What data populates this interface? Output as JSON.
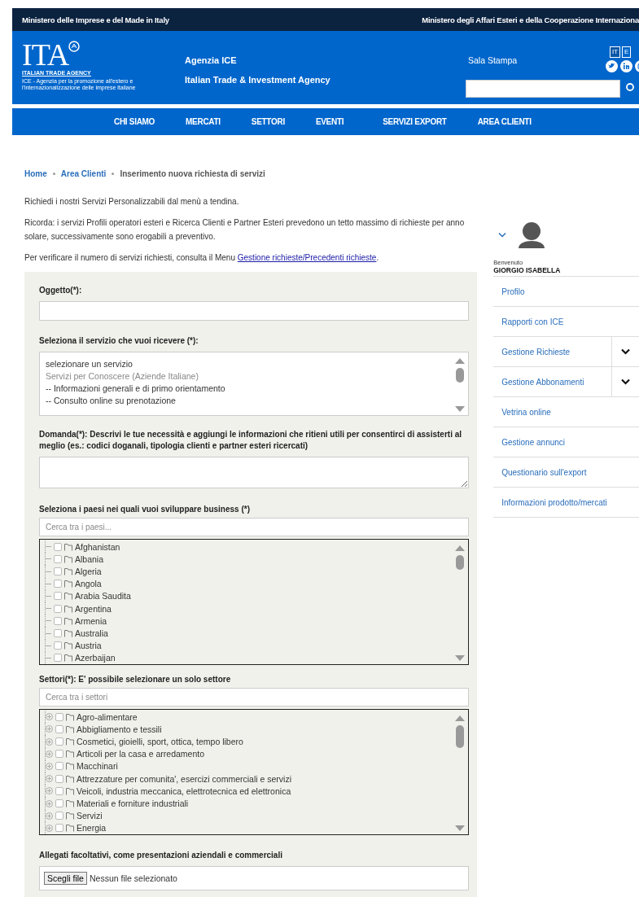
{
  "top_bar": {
    "left": "Ministero delle Imprese e del Made in Italy",
    "right": "Ministero degli Affari Esteri e della Cooperazione Internaziona"
  },
  "header": {
    "logo": {
      "mark": "ITA",
      "name": "ITALIAN TRADE AGENCY",
      "tagline": "ICE - Agenzia per la promozione all'estero e l'internazionalizzazione delle imprese italiane"
    },
    "agency": [
      "Agenzia ICE",
      "Italian Trade & Investment Agency"
    ],
    "press_link": "Sala Stampa",
    "languages": [
      {
        "label": "IT",
        "selected": true
      },
      {
        "label": "E",
        "selected": false
      }
    ]
  },
  "nav": [
    "CHI SIAMO",
    "MERCATI",
    "SETTORI",
    "EVENTI",
    "SERVIZI EXPORT",
    "AREA CLIENTI"
  ],
  "breadcrumb": [
    {
      "label": "Home",
      "kind": "link"
    },
    {
      "label": "Area Clienti",
      "kind": "link"
    },
    {
      "label": "Inserimento nuova richiesta di servizi",
      "kind": "current"
    }
  ],
  "intro": [
    "Richiedi i nostri Servizi Personalizzabili dal menù a tendina.",
    "Ricorda: i servizi Profili operatori esteri e Ricerca Clienti e Partner Esteri prevedono un tetto massimo di richieste per anno solare, successivamente sono erogabili a preventivo."
  ],
  "menu_note": {
    "text": "Per verificare il numero di servizi richiesti, consulta il Menu ",
    "link": "Gestione richieste/Precedenti richieste",
    "end": "."
  },
  "form": {
    "subject": {
      "label": "Oggetto(*):"
    },
    "service": {
      "label": "Seleziona il servizio che vuoi ricevere (*):",
      "options": [
        {
          "label": "selezionare un servizio",
          "kind": "option"
        },
        {
          "label": "Servizi per Conoscere (Aziende Italiane)",
          "kind": "group"
        },
        {
          "label": "-- Informazioni generali e di primo orientamento",
          "kind": "option"
        },
        {
          "label": "-- Consulto online su prenotazione",
          "kind": "option"
        }
      ]
    },
    "question": {
      "label": "Domanda(*): Descrivi le tue necessità e aggiungi le informazioni che ritieni utili per consentirci di assisterti al meglio (es.: codici doganali, tipologia clienti e partner esteri ricercati)"
    },
    "countries": {
      "label": "Seleziona i paesi nei quali vuoi sviluppare business (*)",
      "placeholder": "Cerca tra i paesi...",
      "expandable": false,
      "items": [
        {
          "label": "Afghanistan",
          "checked": false
        },
        {
          "label": "Albania",
          "checked": false
        },
        {
          "label": "Algeria",
          "checked": false
        },
        {
          "label": "Angola",
          "checked": false
        },
        {
          "label": "Arabia Saudita",
          "checked": false
        },
        {
          "label": "Argentina",
          "checked": false
        },
        {
          "label": "Armenia",
          "checked": false
        },
        {
          "label": "Australia",
          "checked": false
        },
        {
          "label": "Austria",
          "checked": false
        },
        {
          "label": "Azerbaijan",
          "checked": false
        }
      ]
    },
    "sectors": {
      "label": "Settori(*): E' possibile selezionare un solo settore",
      "placeholder": "Cerca tra i settori",
      "expandable": true,
      "items": [
        {
          "label": "Agro-alimentare",
          "checked": false
        },
        {
          "label": "Abbigliamento e tessili",
          "checked": false
        },
        {
          "label": "Cosmetici, gioielli, sport, ottica, tempo libero",
          "checked": false
        },
        {
          "label": "Articoli per la casa e arredamento",
          "checked": false
        },
        {
          "label": "Macchinari",
          "checked": false
        },
        {
          "label": "Attrezzature per comunita', esercizi commerciali e servizi",
          "checked": false
        },
        {
          "label": "Veicoli, industria meccanica, elettrotecnica ed elettronica",
          "checked": false
        },
        {
          "label": "Materiali e forniture industriali",
          "checked": false
        },
        {
          "label": "Servizi",
          "checked": false
        },
        {
          "label": "Energia",
          "checked": false
        }
      ]
    },
    "attachments": {
      "label": "Allegati facoltativi, come presentazioni aziendali e commerciali",
      "button": "Scegli file",
      "status": "Nessun file selezionato"
    }
  },
  "sidebar": {
    "welcome": "Benvenuto",
    "user": "GIORGIO ISABELLA",
    "items": [
      {
        "label": "Profilo",
        "kind": "link"
      },
      {
        "label": "Rapporti con ICE",
        "kind": "link"
      },
      {
        "label": "Gestione Richieste",
        "kind": "submenu"
      },
      {
        "label": "Gestione Abbonamenti",
        "kind": "submenu"
      },
      {
        "label": "Vetrina online",
        "kind": "link"
      },
      {
        "label": "Gestione annunci",
        "kind": "link"
      },
      {
        "label": "Questionario sull'export",
        "kind": "link"
      },
      {
        "label": "Informazioni prodotto/mercati",
        "kind": "link"
      }
    ]
  }
}
